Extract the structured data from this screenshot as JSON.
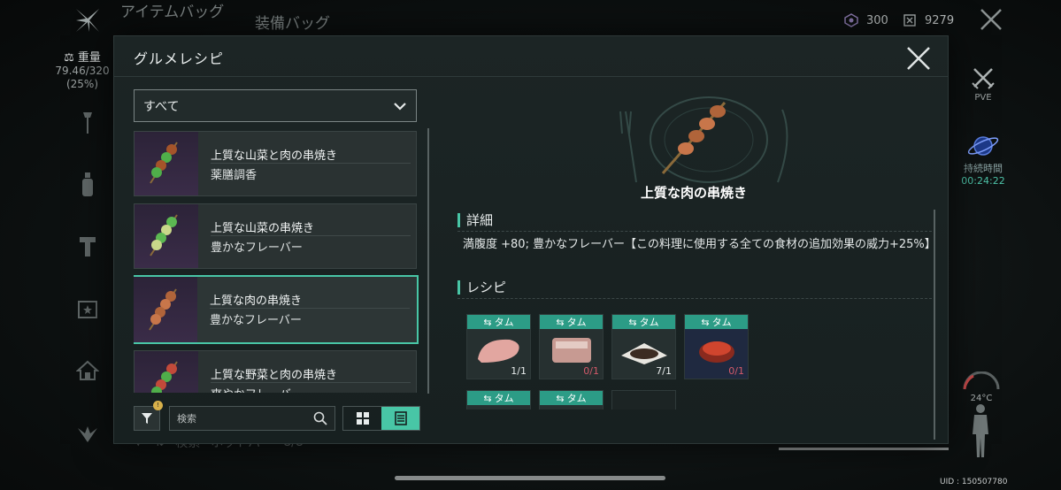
{
  "header_bg": {
    "item_bag_tab": "アイテムバッグ",
    "equip_bag_tab": "装備バッグ",
    "currency_1": "300",
    "currency_2": "9279"
  },
  "left_hud": {
    "weight_label": "重量",
    "weight_value": "79.46/320",
    "weight_percent": "(25%)"
  },
  "right_hud": {
    "mode": "PVE",
    "duration_label": "持続時間",
    "duration_value": "00:24:22",
    "temperature": "24°C",
    "uid": "UID : 150507780"
  },
  "bottom_hud": {
    "search": "検索",
    "hotbar": "ホットバー",
    "hotbar_count": "8/8"
  },
  "modal": {
    "title": "グルメレシピ",
    "filter_selected": "すべて",
    "search_placeholder": "検索",
    "filter_badge": "!",
    "recipes": [
      {
        "name": "上質な山菜と肉の串焼き",
        "effect": "薬膳調香"
      },
      {
        "name": "上質な山菜の串焼き",
        "effect": "豊かなフレーバー"
      },
      {
        "name": "上質な肉の串焼き",
        "effect": "豊かなフレーバー"
      },
      {
        "name": "上質な野菜と肉の串焼き",
        "effect": "爽やかフレーバー"
      }
    ],
    "detail": {
      "title": "上質な肉の串焼き",
      "section_details": "詳細",
      "description": "満腹度 +80; 豊かなフレーバー【この料理に使用する全ての食材の追加効果の威力+25%】",
      "section_recipe": "レシピ",
      "ingredients": [
        {
          "tag": "タム",
          "count": "1/1",
          "have": true
        },
        {
          "tag": "タム",
          "count": "0/1",
          "have": false
        },
        {
          "tag": "タム",
          "count": "7/1",
          "have": true
        },
        {
          "tag": "タム",
          "count": "0/1",
          "have": false
        },
        {
          "tag": "タム",
          "count": "",
          "have": false
        },
        {
          "tag": "タム",
          "count": "",
          "have": false
        }
      ]
    }
  },
  "colors": {
    "accent": "#48c6a6",
    "tag_bg": "#2c9c86",
    "missing": "#d45a6a"
  }
}
